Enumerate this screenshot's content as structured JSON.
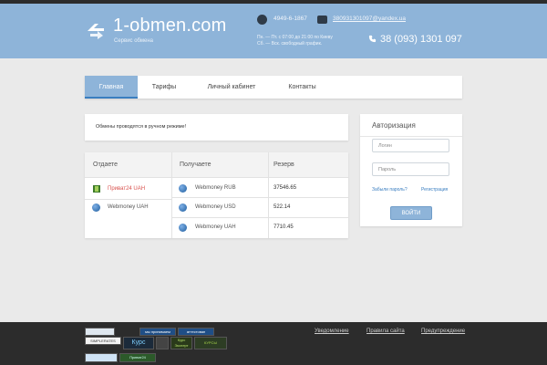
{
  "header": {
    "logo": "1-obmen.com",
    "subtitle": "Сервис обмена",
    "icq": "4949-6-1867",
    "email": "380931301097@yandex.ua",
    "hours_line1": "Пн. — Пт. с 07:00 до 21:00 по Киеву",
    "hours_line2": "Сб. — Вск. свободный график.",
    "phone": "38 (093) 1301 097"
  },
  "nav": {
    "tabs": [
      "Главная",
      "Тарифы",
      "Личный кабинет",
      "Контакты"
    ],
    "active": 0
  },
  "notice": "Обмены проводятся в ручном режиме!",
  "exchange_table": {
    "columns": [
      "Отдаете",
      "Получаете",
      "Резерв"
    ],
    "give": [
      {
        "name": "Приват24 UAH",
        "icon": "privat24-icon",
        "selected": true
      },
      {
        "name": "Webmoney UAH",
        "icon": "webmoney-icon",
        "selected": false
      }
    ],
    "receive": [
      {
        "name": "Webmoney RUB",
        "icon": "webmoney-icon",
        "reserve": "37546.65"
      },
      {
        "name": "Webmoney USD",
        "icon": "webmoney-icon",
        "reserve": "522.14"
      },
      {
        "name": "Webmoney UAH",
        "icon": "webmoney-icon",
        "reserve": "7710.45"
      }
    ]
  },
  "auth": {
    "title": "Авторизация",
    "login_placeholder": "Логин",
    "password_placeholder": "Пароль",
    "forgot": "Забыли пароль?",
    "register": "Регистрация",
    "submit": "ВОЙТИ"
  },
  "footer": {
    "links": [
      "Уведомление",
      "Правила сайта",
      "Предупреждение"
    ],
    "badges": [
      "мы принимаем WebMoney",
      "аттестован WebMoney",
      "SIMPLERATES",
      "Курс",
      "Курс Эксперт",
      "КУРСЫ",
      "Приват24"
    ]
  },
  "colors": {
    "header_bg": "#8eb4d9",
    "footer_bg": "#2c2c2c",
    "accent_link": "#3a7ec0",
    "selected_red": "#d9534f"
  }
}
